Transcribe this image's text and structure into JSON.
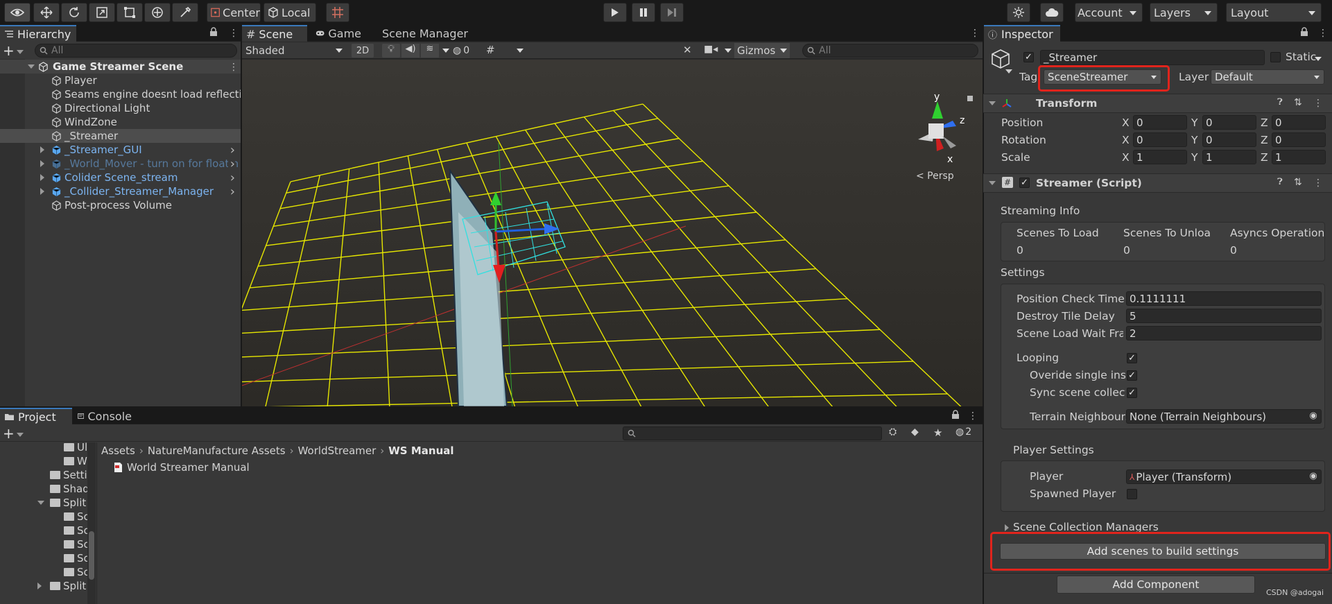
{
  "toolbar": {
    "center_label": "Center",
    "local_label": "Local",
    "account_label": "Account",
    "layers_label": "Layers",
    "layout_label": "Layout"
  },
  "hierarchy": {
    "tab_label": "Hierarchy",
    "search_placeholder": "All",
    "scene_name": "Game Streamer Scene",
    "items": [
      {
        "label": "Player",
        "style": "normal"
      },
      {
        "label": "Seams engine doesnt load reflectio",
        "style": "normal"
      },
      {
        "label": "Directional Light",
        "style": "normal"
      },
      {
        "label": "WindZone",
        "style": "normal"
      },
      {
        "label": "_Streamer",
        "style": "selected"
      },
      {
        "label": "_Streamer_GUI",
        "style": "prefab"
      },
      {
        "label": "_World_Mover - turn on for floatin",
        "style": "prefab-disabled"
      },
      {
        "label": "Colider Scene_stream",
        "style": "prefab"
      },
      {
        "label": "_Collider_Streamer_Manager",
        "style": "prefab"
      },
      {
        "label": "Post-process Volume",
        "style": "normal"
      }
    ]
  },
  "scene_view": {
    "tabs": [
      "Scene",
      "Game",
      "Scene Manager"
    ],
    "shading_mode": "Shaded",
    "mode_2d": "2D",
    "hidden_count": "0",
    "gizmos_label": "Gizmos",
    "search_placeholder": "All",
    "persp_label": "< Persp",
    "axis_labels": {
      "x": "x",
      "y": "y",
      "z": "z"
    }
  },
  "project": {
    "tabs": [
      "Project",
      "Console"
    ],
    "breadcrumb": [
      "Assets",
      "NatureManufacture Assets",
      "WorldStreamer",
      "WS Manual"
    ],
    "hidden_count": "2",
    "tree": [
      {
        "label": "Ul",
        "indent": 3
      },
      {
        "label": "W",
        "indent": 3
      },
      {
        "label": "Setti",
        "indent": 2
      },
      {
        "label": "Shad",
        "indent": 2
      },
      {
        "label": "Split",
        "indent": 2,
        "expanded": true
      },
      {
        "label": "Sc",
        "indent": 3
      },
      {
        "label": "Sc",
        "indent": 3
      },
      {
        "label": "Sc",
        "indent": 3
      },
      {
        "label": "Sc",
        "indent": 3
      },
      {
        "label": "Sc",
        "indent": 3
      },
      {
        "label": "Split",
        "indent": 2,
        "collapsed": true
      }
    ],
    "files": [
      "World Streamer Manual"
    ]
  },
  "inspector": {
    "tab_label": "Inspector",
    "object_name": "_Streamer",
    "static_label": "Static",
    "tag_label": "Tag",
    "tag_value": "SceneStreamer",
    "layer_label": "Layer",
    "layer_value": "Default",
    "transform": {
      "title": "Transform",
      "position_label": "Position",
      "rotation_label": "Rotation",
      "scale_label": "Scale",
      "position": {
        "x": "0",
        "y": "0",
        "z": "0"
      },
      "rotation": {
        "x": "0",
        "y": "0",
        "z": "0"
      },
      "scale": {
        "x": "1",
        "y": "1",
        "z": "1"
      },
      "axis": {
        "x": "X",
        "y": "Y",
        "z": "Z"
      }
    },
    "streamer": {
      "title": "Streamer (Script)",
      "streaming_info_label": "Streaming Info",
      "cols": [
        "Scenes To Load",
        "Scenes To Unloa",
        "Asyncs Operation"
      ],
      "col_values": [
        "0",
        "0",
        "0"
      ],
      "settings_label": "Settings",
      "position_check_time_label": "Position Check Time",
      "position_check_time": "0.1111111",
      "destroy_tile_delay_label": "Destroy Tile Delay",
      "destroy_tile_delay": "5",
      "scene_load_wait_label": "Scene Load Wait Frar",
      "scene_load_wait": "2",
      "looping_label": "Looping",
      "overide_label": "Overide single insta",
      "sync_label": "Sync scene collect",
      "terrain_label": "Terrain Neighbours",
      "terrain_value": "None (Terrain Neighbours)",
      "player_settings_label": "Player Settings",
      "player_label": "Player",
      "player_value": "Player (Transform)",
      "spawned_label": "Spawned Player",
      "scene_collection_label": "Scene Collection Managers",
      "add_scenes_button": "Add scenes to build settings"
    },
    "add_component_button": "Add Component",
    "watermark": "CSDN @adogai"
  },
  "colors": {
    "highlight": "#e0241c",
    "grid": "#e6e600",
    "prefab_text": "#7cb4f0",
    "tab_accent": "#3a79bb"
  }
}
